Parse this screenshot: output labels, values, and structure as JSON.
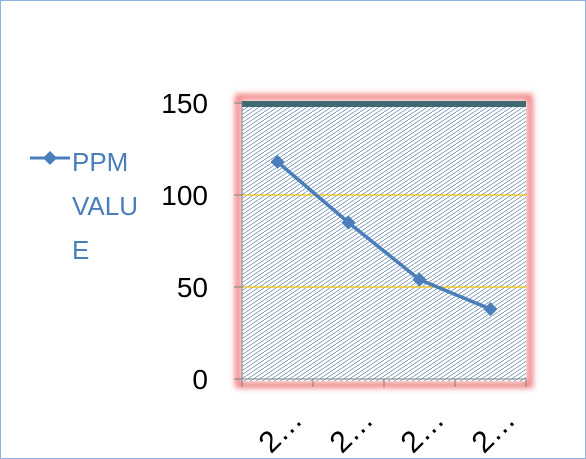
{
  "chart_data": {
    "type": "line",
    "categories": [
      "2…",
      "2…",
      "2…",
      "2…"
    ],
    "series": [
      {
        "name": "PPM VALUE",
        "values": [
          118,
          85,
          54,
          38
        ],
        "color": "#4a7ebb"
      }
    ],
    "yticks": [
      "0",
      "50",
      "100",
      "150"
    ],
    "ylim": [
      0,
      150
    ],
    "grid": true,
    "gridline_color": "#f0c000",
    "plot_border_color": "#e06060",
    "plot_fill": "hatched-blue",
    "legend_placement": "left"
  }
}
